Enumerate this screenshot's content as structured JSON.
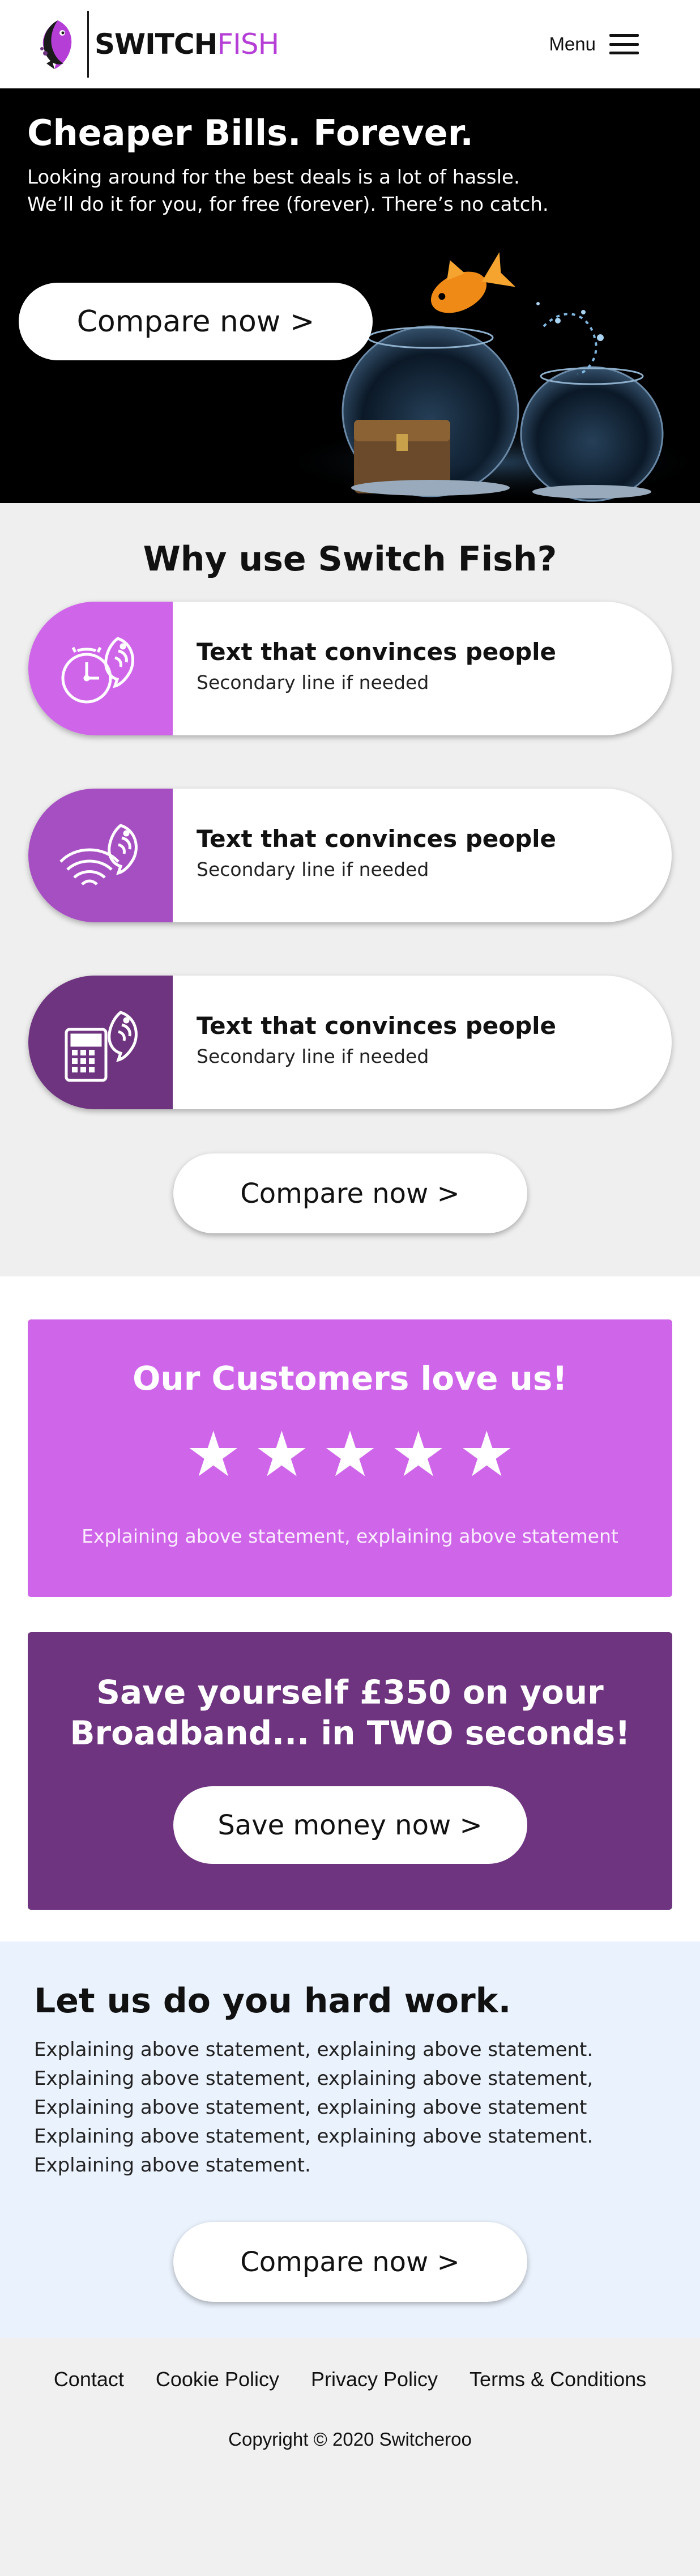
{
  "header": {
    "logo_text_primary": "SWITCH",
    "logo_text_accent": "FISH",
    "menu_label": "Menu"
  },
  "hero": {
    "title": "Cheaper Bills. Forever.",
    "subtitle_line1": "Looking around for the best deals is a lot of hassle.",
    "subtitle_line2": "We’ll do it for you, for free (forever). There’s no catch.",
    "cta_label": "Compare now >"
  },
  "why": {
    "title": "Why use Switch Fish?",
    "cards": [
      {
        "title": "Text that convinces people",
        "subtitle": "Secondary line if needed",
        "icon": "clock-fish-icon",
        "color": "#cf66ea"
      },
      {
        "title": "Text that convinces people",
        "subtitle": "Secondary line if needed",
        "icon": "wifi-fish-icon",
        "color": "#a64fc2"
      },
      {
        "title": "Text that convinces people",
        "subtitle": "Secondary line if needed",
        "icon": "calculator-fish-icon",
        "color": "#6e347f"
      }
    ],
    "cta_label": "Compare now >"
  },
  "reviews": {
    "title": "Our Customers love us!",
    "rating": 5,
    "rating_max": 5,
    "text": "Explaining above statement, explaining above statement"
  },
  "savings": {
    "title_line1": "Save yourself £350 on your",
    "title_line2": "Broadband... in TWO seconds!",
    "cta_label": "Save money now >"
  },
  "hardwork": {
    "title": "Let us do you hard work.",
    "lines": [
      "Explaining above statement, explaining above statement.",
      "Explaining above statement, explaining above statement,",
      "Explaining above statement, explaining above statement",
      "Explaining above statement, explaining above statement.",
      "Explaining above statement."
    ],
    "cta_label": "Compare now >"
  },
  "footer": {
    "links": [
      "Contact",
      "Cookie Policy",
      "Privacy Policy",
      "Terms & Conditions"
    ],
    "copyright": "Copyright © 2020 Switcheroo"
  },
  "colors": {
    "brand_purple": "#b53fd6",
    "light_purple": "#cf66ea",
    "mid_purple": "#a64fc2",
    "dark_purple": "#6e347f",
    "hardwork_bg": "#eaf2fd"
  }
}
